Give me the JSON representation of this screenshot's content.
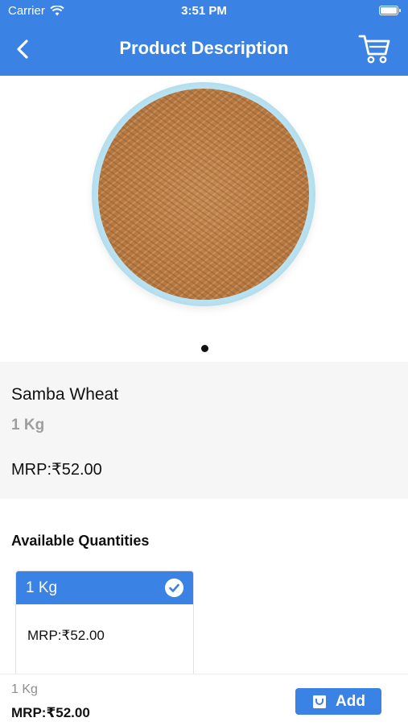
{
  "status_bar": {
    "carrier": "Carrier",
    "time": "3:51 PM"
  },
  "header": {
    "title": "Product Description",
    "back_icon": "chevron-left-icon",
    "cart_icon": "cart-icon"
  },
  "product": {
    "name": "Samba Wheat",
    "unit": "1 Kg",
    "mrp": "MRP:₹52.00",
    "image": "samba-wheat-grains-in-bowl"
  },
  "carousel": {
    "pages": 1,
    "current": 1
  },
  "quantities": {
    "heading": "Available Quantities",
    "options": [
      {
        "label": "1 Kg",
        "price": "MRP:₹52.00",
        "selected": true
      }
    ]
  },
  "footer": {
    "unit": "1 Kg",
    "mrp": "MRP:₹52.00",
    "add_label": "Add"
  },
  "colors": {
    "primary": "#3a82e4",
    "info_bg": "#f6f6f6",
    "muted": "#9e9e9e"
  }
}
